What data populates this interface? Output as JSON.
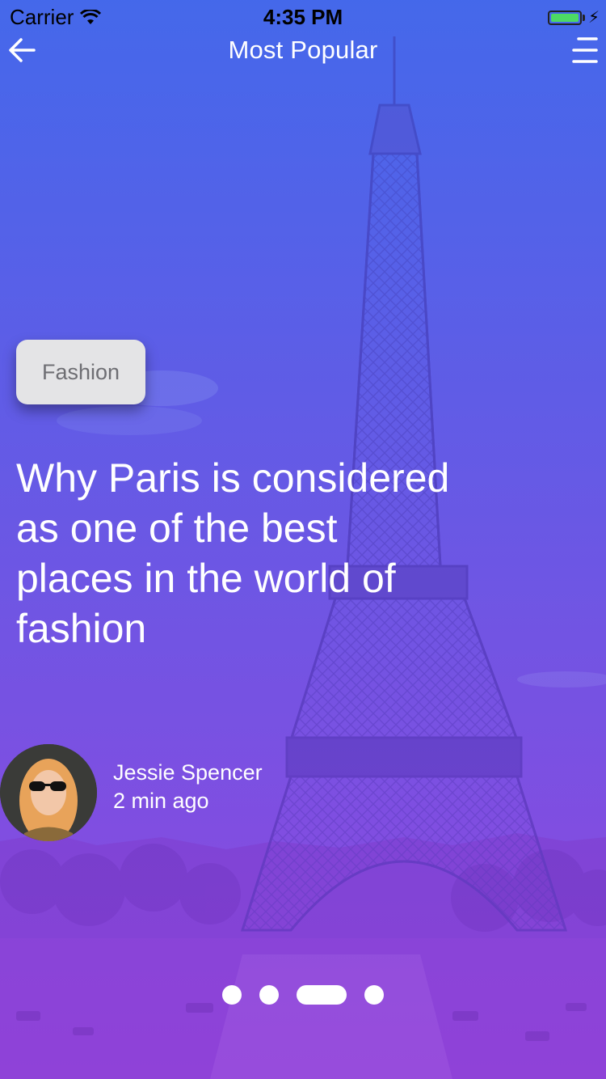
{
  "status_bar": {
    "carrier": "Carrier",
    "time": "4:35 PM",
    "battery_level": 1.0
  },
  "nav": {
    "title": "Most Popular",
    "back_icon": "arrow-left-icon",
    "menu_icon": "hamburger-menu-icon"
  },
  "article": {
    "category": "Fashion",
    "headline": "Why Paris is considered as one of the best places in the world of fashion",
    "author": {
      "name": "Jessie Spencer",
      "time_ago": "2 min ago"
    }
  },
  "pager": {
    "count": 4,
    "active_index": 2
  },
  "colors": {
    "overlay_top": "#4066e6",
    "overlay_bottom": "#9640de",
    "chip_bg": "#e4e4e6",
    "chip_text": "#6e6e73",
    "battery_green": "#4cd964"
  }
}
